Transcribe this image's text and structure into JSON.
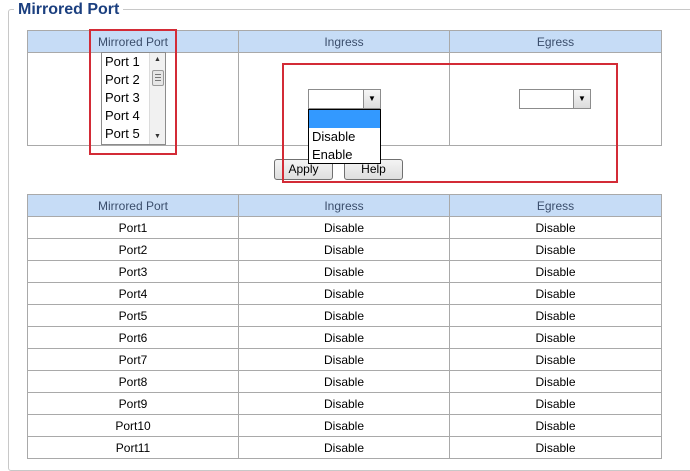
{
  "page": {
    "title": "Mirrored Port"
  },
  "config": {
    "headers": [
      "Mirrored Port",
      "Ingress",
      "Egress"
    ],
    "port_list": [
      "Port 1",
      "Port 2",
      "Port 3",
      "Port 4",
      "Port 5"
    ],
    "ingress_dropdown_options": [
      "",
      "Disable",
      "Enable"
    ],
    "ingress_value": "",
    "egress_value": ""
  },
  "buttons": {
    "apply": "Apply",
    "help": "Help"
  },
  "status": {
    "headers": [
      "Mirrored Port",
      "Ingress",
      "Egress"
    ],
    "rows": [
      [
        "Port1",
        "Disable",
        "Disable"
      ],
      [
        "Port2",
        "Disable",
        "Disable"
      ],
      [
        "Port3",
        "Disable",
        "Disable"
      ],
      [
        "Port4",
        "Disable",
        "Disable"
      ],
      [
        "Port5",
        "Disable",
        "Disable"
      ],
      [
        "Port6",
        "Disable",
        "Disable"
      ],
      [
        "Port7",
        "Disable",
        "Disable"
      ],
      [
        "Port8",
        "Disable",
        "Disable"
      ],
      [
        "Port9",
        "Disable",
        "Disable"
      ],
      [
        "Port10",
        "Disable",
        "Disable"
      ],
      [
        "Port11",
        "Disable",
        "Disable"
      ]
    ]
  },
  "colors": {
    "header_bg": "#c6dcf6",
    "title": "#1b3f7f",
    "highlight_box": "#d32b36",
    "selected_option": "#3399ff"
  }
}
